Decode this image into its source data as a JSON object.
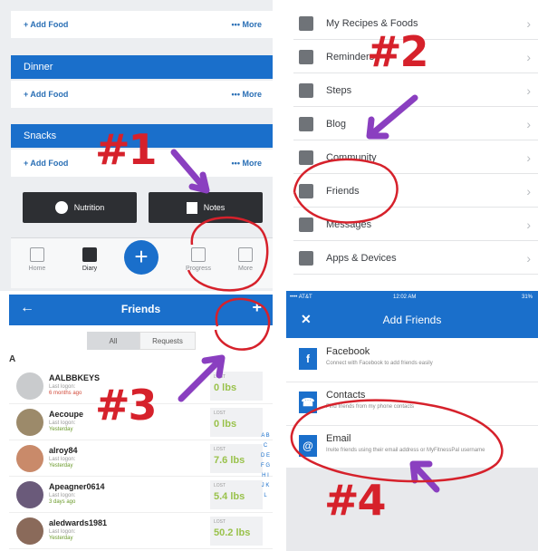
{
  "colors": {
    "brand_blue": "#1a6fcb",
    "annotation_red": "#d6212b",
    "arrow_purple": "#8a3fc0"
  },
  "diary": {
    "add_food": "+ Add Food",
    "more": "••• More",
    "meals": [
      "Dinner",
      "Snacks"
    ],
    "nutrition_label": "Nutrition",
    "notes_label": "Notes",
    "tabs": [
      "Home",
      "Diary",
      "Progress",
      "More"
    ]
  },
  "menu": {
    "items": [
      {
        "label": "My Recipes & Foods",
        "icon": "chef-hat-icon"
      },
      {
        "label": "Reminders",
        "icon": "alarm-clock-icon"
      },
      {
        "label": "Steps",
        "icon": "footsteps-icon"
      },
      {
        "label": "Blog",
        "icon": "newspaper-icon"
      },
      {
        "label": "Community",
        "icon": "chat-icon"
      },
      {
        "label": "Friends",
        "icon": "people-icon"
      },
      {
        "label": "Messages",
        "icon": "mail-icon"
      },
      {
        "label": "Apps & Devices",
        "icon": "link-icon"
      }
    ]
  },
  "friends": {
    "title": "Friends",
    "tab_all": "All",
    "tab_requests": "Requests",
    "section": "A",
    "list": [
      {
        "name": "AALBBKEYS",
        "line1": "Last logon:",
        "line2": "6 months ago",
        "stale": true,
        "lost_label": "LOST",
        "lost": "0 lbs",
        "avatar_color": "#c9cbcd"
      },
      {
        "name": "Aecoupe",
        "line1": "Last logon:",
        "line2": "Yesterday",
        "stale": false,
        "lost_label": "LOST",
        "lost": "0 lbs",
        "avatar_color": "#9c8a6a"
      },
      {
        "name": "alroy84",
        "line1": "Last logon:",
        "line2": "Yesterday",
        "stale": false,
        "lost_label": "LOST",
        "lost": "7.6 lbs",
        "avatar_color": "#c98a6a"
      },
      {
        "name": "Apeagner0614",
        "line1": "Last logon:",
        "line2": "3 days ago",
        "stale": false,
        "lost_label": "LOST",
        "lost": "5.4 lbs",
        "avatar_color": "#6a5a7a"
      },
      {
        "name": "aledwards1981",
        "line1": "Last logon:",
        "line2": "Yesterday",
        "stale": false,
        "lost_label": "LOST",
        "lost": "50.2 lbs",
        "avatar_color": "#8a6a5a"
      }
    ],
    "index_letters": "A B C D E F G H I J K L"
  },
  "add_friends": {
    "status_carrier": "•••• AT&T",
    "status_time": "12:02 AM",
    "status_battery": "31%",
    "title": "Add Friends",
    "options": [
      {
        "title": "Facebook",
        "desc": "Connect with Facebook to add friends easily",
        "icon": "facebook-icon",
        "glyph": "f"
      },
      {
        "title": "Contacts",
        "desc": "Find friends from my phone contacts",
        "icon": "contacts-book-icon",
        "glyph": "☎"
      },
      {
        "title": "Email",
        "desc": "Invite friends using their email address or MyFitnessPal username",
        "icon": "email-at-icon",
        "glyph": "@"
      }
    ]
  },
  "annotations": {
    "n1": "#1",
    "n2": "#2",
    "n3": "#3",
    "n4": "#4"
  }
}
